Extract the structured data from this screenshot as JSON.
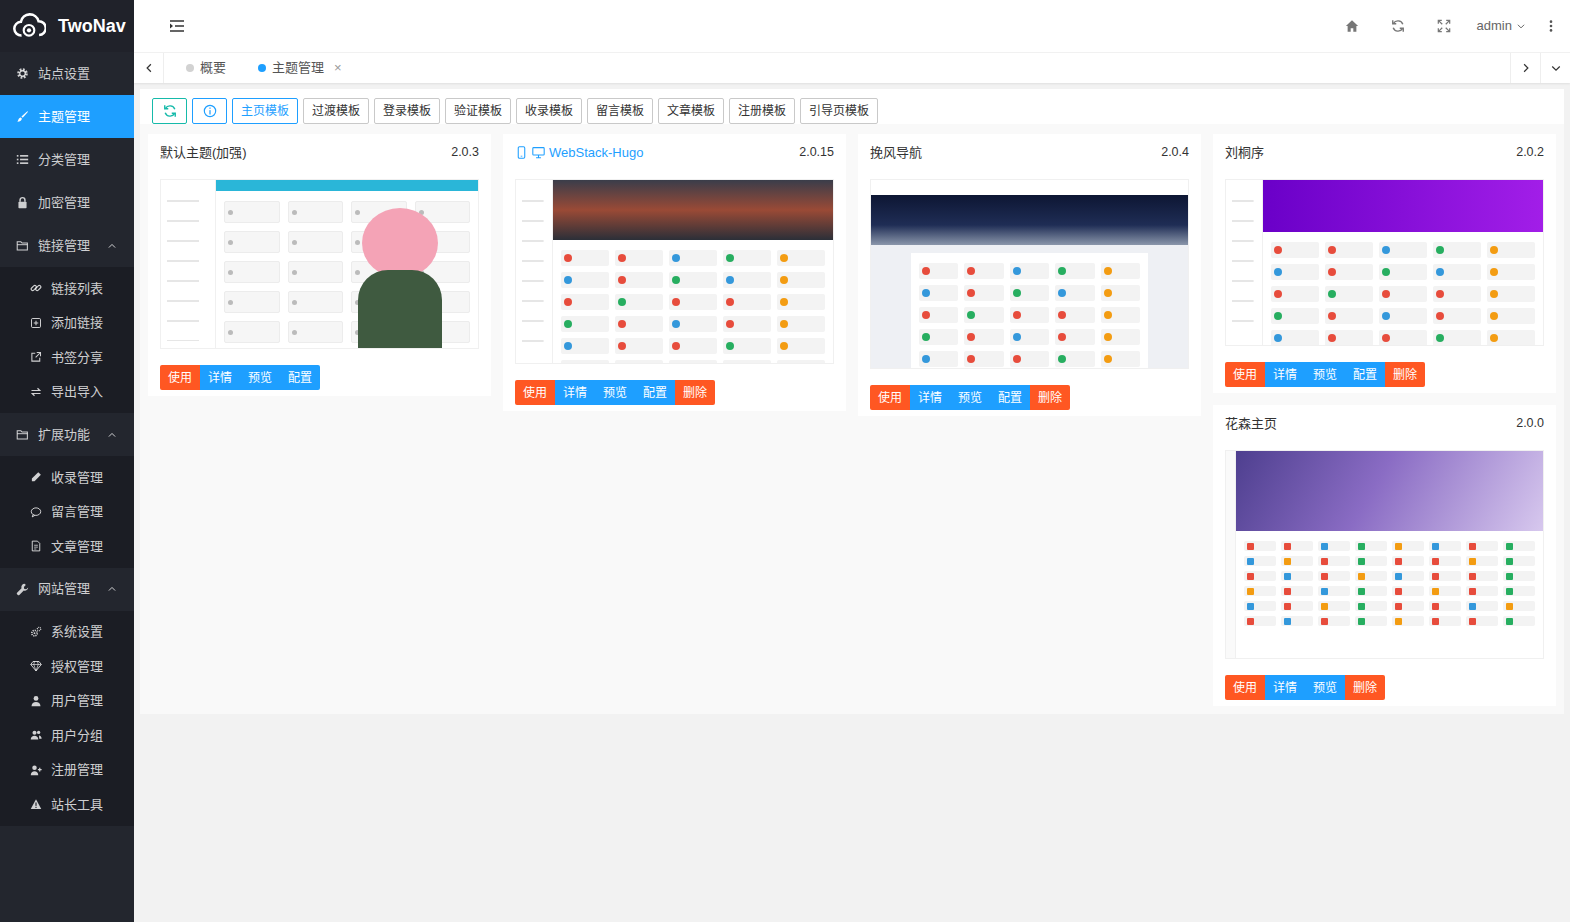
{
  "brand": {
    "name": "TwoNav"
  },
  "sidebar": {
    "items": [
      {
        "label": "站点设置",
        "kind": "item",
        "selected": false
      },
      {
        "label": "主题管理",
        "kind": "item",
        "selected": true
      },
      {
        "label": "分类管理",
        "kind": "item",
        "selected": false
      },
      {
        "label": "加密管理",
        "kind": "item",
        "selected": false
      },
      {
        "label": "链接管理",
        "kind": "group",
        "expanded": true,
        "children": [
          {
            "label": "链接列表",
            "selected": false
          },
          {
            "label": "添加链接",
            "selected": false
          },
          {
            "label": "书签分享",
            "selected": false
          },
          {
            "label": "导出导入",
            "selected": false
          }
        ]
      },
      {
        "label": "扩展功能",
        "kind": "group",
        "expanded": true,
        "children": [
          {
            "label": "收录管理",
            "selected": false
          },
          {
            "label": "留言管理",
            "selected": false
          },
          {
            "label": "文章管理",
            "selected": false
          }
        ]
      },
      {
        "label": "网站管理",
        "kind": "group",
        "expanded": true,
        "children": [
          {
            "label": "系统设置",
            "selected": false
          },
          {
            "label": "授权管理",
            "selected": false
          },
          {
            "label": "用户管理",
            "selected": false
          },
          {
            "label": "用户分组",
            "selected": false
          },
          {
            "label": "注册管理",
            "selected": false
          },
          {
            "label": "站长工具",
            "selected": false
          }
        ]
      }
    ]
  },
  "header": {
    "user": "admin"
  },
  "tabs": [
    {
      "label": "概要",
      "selected": false
    },
    {
      "label": "主题管理",
      "selected": true,
      "close": "×"
    }
  ],
  "template_tabs": [
    {
      "label": "主页模板",
      "selected": true
    },
    {
      "label": "过渡模板",
      "selected": false
    },
    {
      "label": "登录模板",
      "selected": false
    },
    {
      "label": "验证模板",
      "selected": false
    },
    {
      "label": "收录模板",
      "selected": false
    },
    {
      "label": "留言模板",
      "selected": false
    },
    {
      "label": "文章模板",
      "selected": false
    },
    {
      "label": "注册模板",
      "selected": false
    },
    {
      "label": "引导页模板",
      "selected": false
    }
  ],
  "themes": [
    {
      "title": "默认主题(加强)",
      "version": "2.0.3",
      "in_use": false,
      "buttons": [
        {
          "label": "使用",
          "kind": "use"
        },
        {
          "label": "详情",
          "kind": "info"
        },
        {
          "label": "预览",
          "kind": "info"
        },
        {
          "label": "配置",
          "kind": "info"
        }
      ]
    },
    {
      "title": "WebStack-Hugo",
      "version": "2.0.15",
      "in_use": true,
      "buttons": [
        {
          "label": "使用",
          "kind": "use"
        },
        {
          "label": "详情",
          "kind": "info"
        },
        {
          "label": "预览",
          "kind": "info"
        },
        {
          "label": "配置",
          "kind": "info"
        },
        {
          "label": "删除",
          "kind": "delete"
        }
      ]
    },
    {
      "title": "挽风导航",
      "version": "2.0.4",
      "in_use": false,
      "buttons": [
        {
          "label": "使用",
          "kind": "use"
        },
        {
          "label": "详情",
          "kind": "info"
        },
        {
          "label": "预览",
          "kind": "info"
        },
        {
          "label": "配置",
          "kind": "info"
        },
        {
          "label": "删除",
          "kind": "delete"
        }
      ]
    },
    {
      "title": "刘桐序",
      "version": "2.0.2",
      "in_use": false,
      "buttons": [
        {
          "label": "使用",
          "kind": "use"
        },
        {
          "label": "详情",
          "kind": "info"
        },
        {
          "label": "预览",
          "kind": "info"
        },
        {
          "label": "配置",
          "kind": "info"
        },
        {
          "label": "删除",
          "kind": "delete"
        }
      ]
    },
    {
      "title": "花森主页",
      "version": "2.0.0",
      "in_use": false,
      "buttons": [
        {
          "label": "使用",
          "kind": "use"
        },
        {
          "label": "详情",
          "kind": "info"
        },
        {
          "label": "预览",
          "kind": "info"
        },
        {
          "label": "删除",
          "kind": "delete"
        }
      ]
    }
  ]
}
